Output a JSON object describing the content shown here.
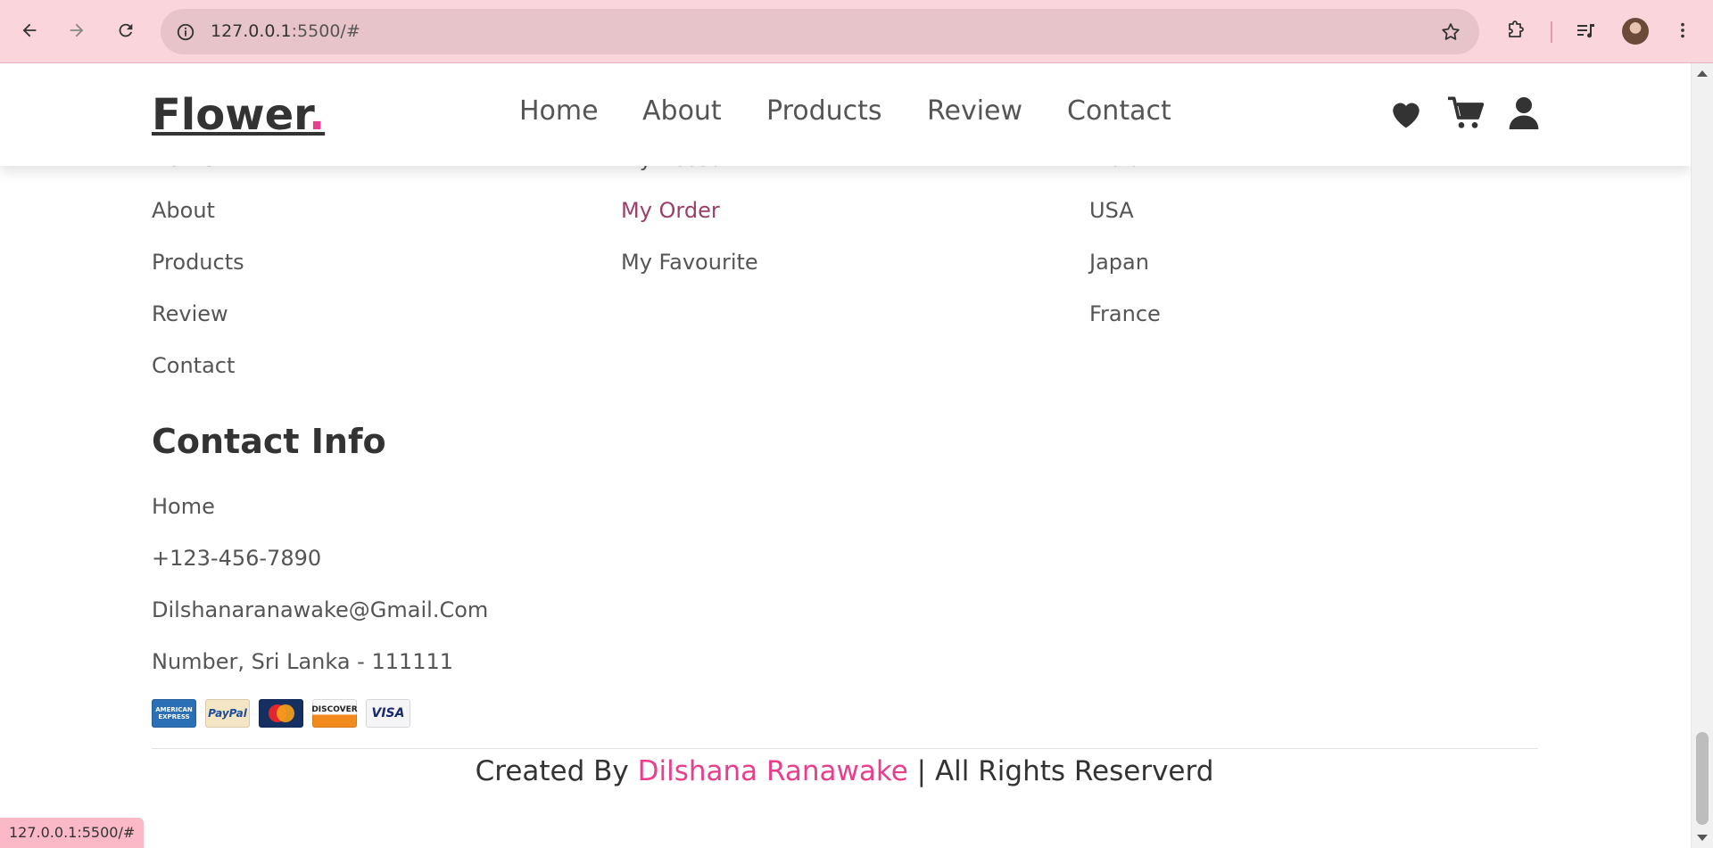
{
  "browser": {
    "url_host": "127.0.0.1",
    "url_rest": ":5500/#",
    "status_url": "127.0.0.1:5500/#"
  },
  "header": {
    "logo_text": "Flower",
    "logo_dot": ".",
    "nav": [
      "Home",
      "About",
      "Products",
      "Review",
      "Contact"
    ]
  },
  "footer": {
    "quick_links": [
      "Home",
      "About",
      "Products",
      "Review",
      "Contact"
    ],
    "extra_links": [
      "My Account",
      "My Order",
      "My Favourite"
    ],
    "locations": [
      "India",
      "USA",
      "Japan",
      "France"
    ],
    "contact_title": "Contact Info",
    "contact_items": [
      "Home",
      "+123-456-7890",
      "Dilshanaranawake@Gmail.Com",
      "Number, Sri Lanka - 111111"
    ],
    "payment_cards": {
      "amex": "AMERICAN EXPRESS",
      "paypal": "PayPal",
      "mastercard": "MasterCard",
      "discover": "DISCOVER",
      "visa": "VISA"
    },
    "credit_prefix": "Created By ",
    "credit_name": "Dilshana Ranawake",
    "credit_suffix": " | All Rights Reserverd"
  },
  "colors": {
    "accent": "#e83e8c",
    "chrome_bg": "#fad6dc",
    "active_link": "#9c3e69"
  },
  "icons": [
    "back-arrow-icon",
    "forward-arrow-icon",
    "reload-icon",
    "site-info-icon",
    "bookmark-star-icon",
    "extensions-icon",
    "media-control-icon",
    "profile-avatar",
    "kebab-menu-icon",
    "heart-icon",
    "shopping-cart-icon",
    "user-icon"
  ]
}
